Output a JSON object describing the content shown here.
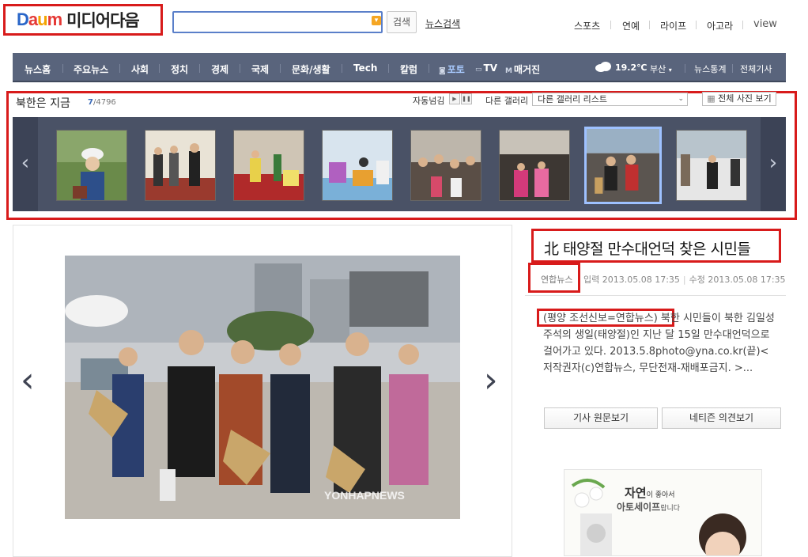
{
  "header": {
    "logo_main": "D",
    "logo_a": "a",
    "logo_u": "u",
    "logo_m": "m",
    "logo_text": "미디어다음",
    "search_button": "검색",
    "news_search": "뉴스검색",
    "top_links": [
      "스포츠",
      "연예",
      "라이프",
      "아고라",
      "view"
    ]
  },
  "nav": {
    "items": [
      "뉴스홈",
      "주요뉴스",
      "사회",
      "정치",
      "경제",
      "국제",
      "문화/생활",
      "Tech",
      "칼럼"
    ],
    "media": [
      "포토",
      "TV",
      "매거진"
    ],
    "weather_temp": "19.2℃",
    "weather_city": "부산",
    "stats": "뉴스통계",
    "all_articles": "전체기사"
  },
  "gallery": {
    "title": "북한은 지금",
    "current": "7",
    "total": "/4796",
    "autoplay_label": "자동넘김",
    "other_gallery_label": "다른 갤러리",
    "select_value": "다른 갤러리 리스트",
    "view_all": "전체 사진 보기",
    "selected_index": 6
  },
  "article": {
    "title": "北 태양절 만수대언덕 찾은 시민들",
    "source": "연합뉴스",
    "input_time": "입력 2013.05.08 17:35",
    "modified_time": "수정 2013.05.08 17:35",
    "body_lead": "(평양 조선신보=연합뉴스)",
    "body_rest": " 북한 시민들이 북한 김일성 주석의 생일(태양절)인 지난 달 15일 만수대언덕으로 걸어가고 있다. 2013.5.8photo@yna.co.kr(끝)< 저작권자(c)연합뉴스, 무단전재-재배포금지. >...",
    "btn_original": "기사 원문보기",
    "btn_comments": "네티즌 의견보기",
    "watermark": "YONHAPNEWS"
  },
  "ad": {
    "title": "자연",
    "title_small": "이 좋아서",
    "sub": "아토세이프",
    "sub_small": "랍니다"
  }
}
